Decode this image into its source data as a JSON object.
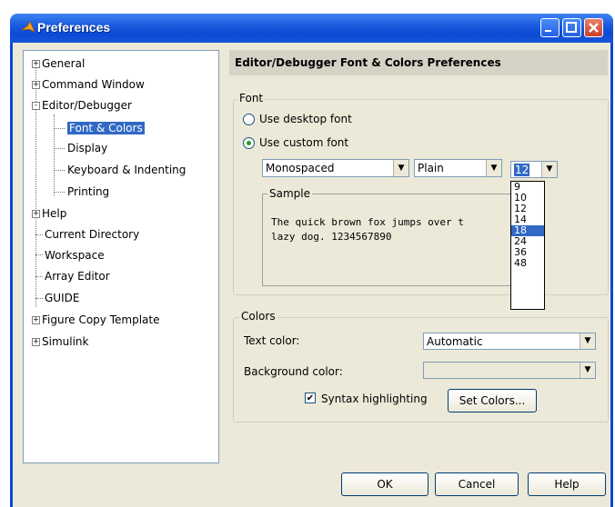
{
  "window": {
    "title": "Preferences"
  },
  "tree": {
    "items": [
      {
        "label": "General",
        "expander": "+"
      },
      {
        "label": "Command Window",
        "expander": "+"
      },
      {
        "label": "Editor/Debugger",
        "expander": "-"
      },
      {
        "label": "Font & Colors"
      },
      {
        "label": "Display"
      },
      {
        "label": "Keyboard & Indenting"
      },
      {
        "label": "Printing"
      },
      {
        "label": "Help",
        "expander": "+"
      },
      {
        "label": "Current Directory"
      },
      {
        "label": "Workspace"
      },
      {
        "label": "Array Editor"
      },
      {
        "label": "GUIDE"
      },
      {
        "label": "Figure Copy Template",
        "expander": "+"
      },
      {
        "label": "Simulink",
        "expander": "+"
      }
    ]
  },
  "panel": {
    "header": "Editor/Debugger Font & Colors Preferences"
  },
  "font": {
    "group_title": "Font",
    "desktop_option": "Use desktop font",
    "custom_option": "Use custom font",
    "family_value": "Monospaced",
    "style_value": "Plain",
    "size_value": "12",
    "sample_title": "Sample",
    "sample_line1": "The quick brown fox jumps over t",
    "sample_line2": "lazy dog. 1234567890",
    "size_options": [
      "9",
      "10",
      "12",
      "14",
      "18",
      "24",
      "36",
      "48"
    ],
    "highlighted_size": "18"
  },
  "colors": {
    "group_title": "Colors",
    "text_color_label": "Text color:",
    "text_color_value": "Automatic",
    "background_color_label": "Background color:",
    "background_color_value": "",
    "syntax_label": "Syntax highlighting",
    "syntax_checked": "✔",
    "set_colors_label": "Set Colors..."
  },
  "buttons": {
    "ok": "OK",
    "cancel": "Cancel",
    "help": "Help"
  },
  "glyphs": {
    "dropdown_arrow": "▼"
  }
}
